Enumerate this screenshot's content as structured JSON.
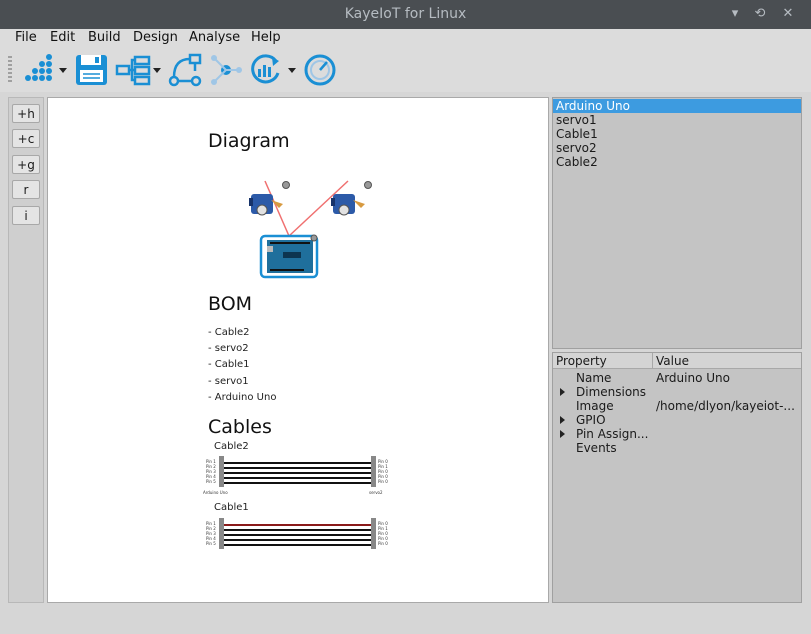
{
  "window": {
    "title": "KayeIoT for Linux",
    "min": "▾",
    "restore": "⟲",
    "close": "✕"
  },
  "menu": [
    "File",
    "Edit",
    "Build",
    "Design",
    "Analyse",
    "Help"
  ],
  "toolbar_icons": [
    "network-nodes-icon",
    "save-icon",
    "tree-structure-icon",
    "workflow-icon",
    "connections-icon",
    "refresh-chart-icon",
    "gauge-icon"
  ],
  "side_buttons": [
    "+h",
    "+c",
    "+g",
    "r",
    "i"
  ],
  "canvas": {
    "diagram_heading": "Diagram",
    "bom_heading": "BOM",
    "bom_items": [
      "- Cable2",
      "- servo2",
      "- Cable1",
      "- servo1",
      "- Arduino Uno"
    ],
    "cables_heading": "Cables",
    "cables": [
      {
        "name": "Cable2",
        "left_pins": [
          "Pin 1",
          "Pin 2",
          "Pin 3",
          "Pin 4",
          "Pin 5"
        ],
        "right_pins": [
          "Pin 0",
          "Pin 1",
          "Pin 0",
          "Pin 0",
          "Pin 0"
        ],
        "left_label": "Arduino Uno",
        "right_label": "servo2"
      },
      {
        "name": "Cable1",
        "left_pins": [
          "Pin 1",
          "Pin 2",
          "Pin 3",
          "Pin 4",
          "Pin 5"
        ],
        "right_pins": [
          "Pin 0",
          "Pin 1",
          "Pin 0",
          "Pin 0",
          "Pin 0"
        ]
      }
    ]
  },
  "components": [
    "Arduino Uno",
    "servo1",
    "Cable1",
    "servo2",
    "Cable2"
  ],
  "selected_component": "Arduino Uno",
  "properties": {
    "col_property": "Property",
    "col_value": "Value",
    "rows": [
      {
        "key": "Name",
        "value": "Arduino Uno",
        "expandable": false
      },
      {
        "key": "Dimensions",
        "value": "",
        "expandable": true
      },
      {
        "key": "Image",
        "value": "/home/dlyon/kayeiot-...",
        "expandable": false
      },
      {
        "key": "GPIO",
        "value": "",
        "expandable": true
      },
      {
        "key": "Pin Assign...",
        "value": "",
        "expandable": true
      },
      {
        "key": "Events",
        "value": "",
        "expandable": false
      }
    ]
  },
  "colors": {
    "accent": "#1a8fd4",
    "selection": "#3d9be0",
    "wire_red": "#f07070",
    "cable_dark": "#111111"
  }
}
